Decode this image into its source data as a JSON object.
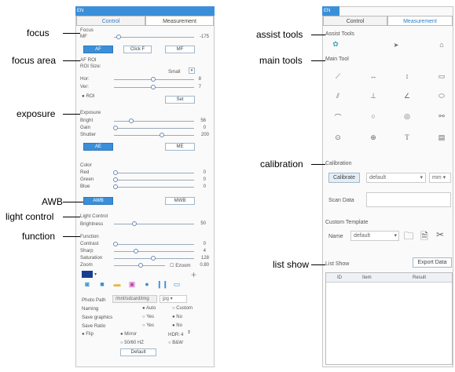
{
  "annotations": {
    "left": [
      "focus",
      "focus area",
      "exposure",
      "AWB",
      "light control",
      "function"
    ],
    "right": [
      "assist tools",
      "main tools",
      "calibration",
      "list show"
    ]
  },
  "left_panel": {
    "lang": "EN",
    "tabs": [
      "Control",
      "Measurement"
    ],
    "focus": {
      "title": "Focus",
      "mf_label": "MF",
      "mf_value": "-175",
      "btns": [
        "AF",
        "Click F",
        "MF"
      ]
    },
    "af_roi": {
      "title": "AF ROI",
      "roi_size_label": "ROI Size:",
      "roi_size_value": "Small",
      "hor_label": "Hor:",
      "hor_value": "8",
      "ver_label": "Ver:",
      "ver_value": "7",
      "roi_check": "ROI",
      "set": "Set"
    },
    "exposure": {
      "title": "Exposure",
      "bright": "Bright",
      "bright_v": "56",
      "gain": "Gain",
      "gain_v": "0",
      "shutter": "Shutter",
      "shutter_v": "200",
      "btns": [
        "AE",
        "ME"
      ]
    },
    "color": {
      "title": "Color",
      "red": "Red",
      "red_v": "0",
      "green": "Green",
      "green_v": "0",
      "blue": "Blue",
      "blue_v": "0",
      "btns": [
        "AWB",
        "MWB"
      ]
    },
    "light": {
      "title": "Light Control",
      "brightness": "Brightness",
      "brightness_v": "50"
    },
    "function": {
      "title": "Function",
      "contrast": "Contrast",
      "contrast_v": "0",
      "sharp": "Sharp",
      "sharp_v": "4",
      "saturation": "Saturation",
      "saturation_v": "128",
      "zoom": "Zoom",
      "zoom_check": "Ezoom",
      "zoom_v": "0.80"
    },
    "swatch_color": "#1a3f8f",
    "settings": {
      "photo_path_label": "Photo Path",
      "photo_path_value": "/mnt/sdcard/img",
      "format": "jpg",
      "naming_label": "Naming",
      "naming_opts": [
        "Auto",
        "Custom"
      ],
      "save_graphics_label": "Save graphics",
      "sg_opts": [
        "Yes",
        "No"
      ],
      "save_ratio_label": "Save Ratio",
      "sr_opts": [
        "Yes",
        "No"
      ],
      "flip": "Flip",
      "mirror": "Mirror",
      "hdr_label": "HDR:",
      "hdr_value": "4",
      "hz": "50/60 HZ",
      "bw": "B&W",
      "default": "Default"
    }
  },
  "right_panel": {
    "lang": "EN",
    "tabs": [
      "Control",
      "Measurement"
    ],
    "assist_title": "Assist Tools",
    "main_title": "Main Tool",
    "calibration_title": "Calibration",
    "calibrate_btn": "Calibrate",
    "cal_select": "default",
    "unit": "mm",
    "scan_label": "Scan Data",
    "custom_title": "Custom Template",
    "name_label": "Name",
    "name_value": "default",
    "list_show": "List Show",
    "export": "Export Data",
    "cols": [
      "ID",
      "Item",
      "Result"
    ]
  },
  "accent": "#3b8fd9"
}
